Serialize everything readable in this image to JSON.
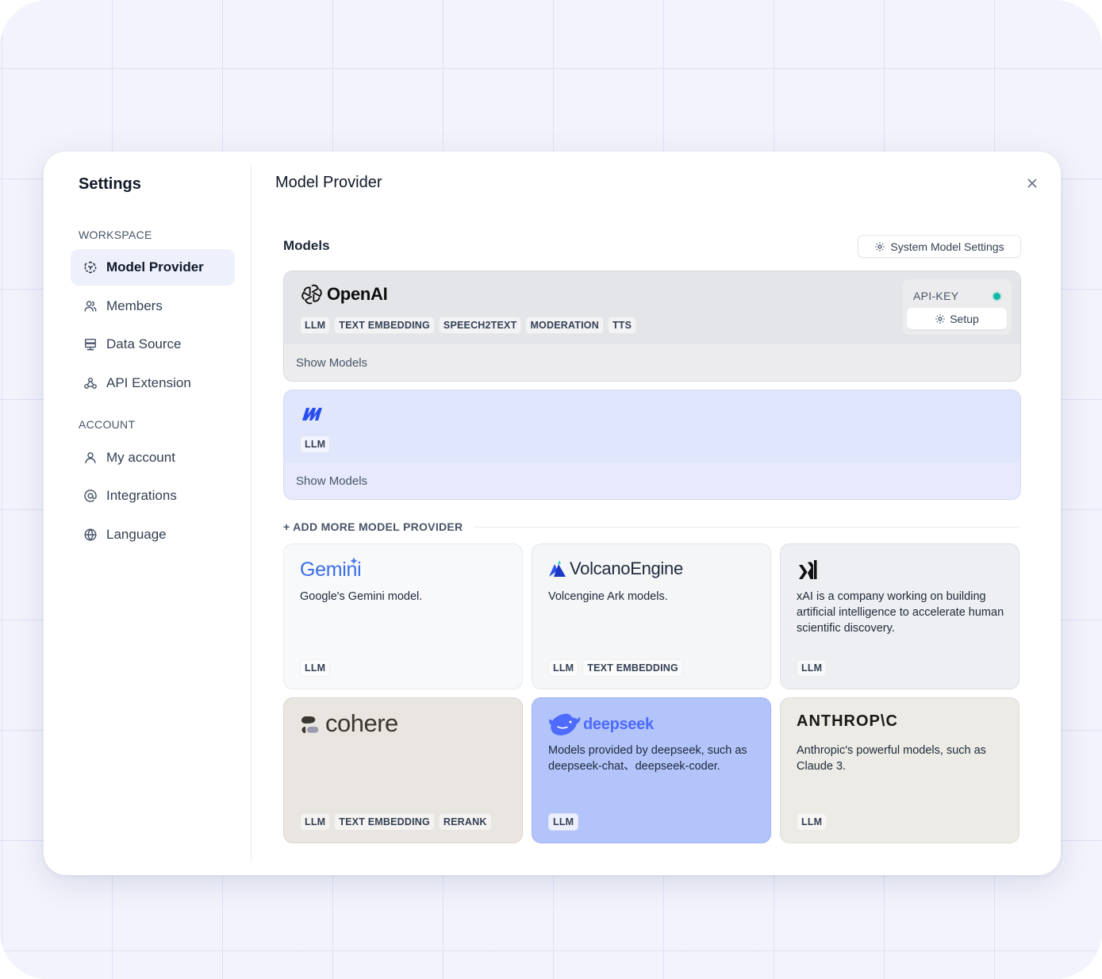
{
  "sidebar": {
    "title": "Settings",
    "workspace_label": "WORKSPACE",
    "account_label": "ACCOUNT",
    "items": [
      {
        "label": "Model Provider",
        "icon": "cube-icon",
        "active": true
      },
      {
        "label": "Members",
        "icon": "users-icon"
      },
      {
        "label": "Data Source",
        "icon": "database-icon"
      },
      {
        "label": "API Extension",
        "icon": "webhook-icon"
      },
      {
        "label": "My account",
        "icon": "user-icon"
      },
      {
        "label": "Integrations",
        "icon": "at-sign-icon"
      },
      {
        "label": "Language",
        "icon": "globe-icon"
      }
    ]
  },
  "main": {
    "title": "Model Provider",
    "models_label": "Models",
    "system_settings_label": "System Model Settings",
    "configured": [
      {
        "name": "OpenAI",
        "tags": [
          "LLM",
          "TEXT EMBEDDING",
          "SPEECH2TEXT",
          "MODERATION",
          "TTS"
        ],
        "api_key_label": "API-KEY",
        "setup_label": "Setup",
        "show_models": "Show Models",
        "status_color": "#14b8a6"
      },
      {
        "name": "",
        "icon": "moonshot-logo-icon",
        "tags": [
          "LLM"
        ],
        "show_models": "Show Models"
      }
    ],
    "add_more_label": "+ ADD MORE MODEL PROVIDER",
    "providers": [
      {
        "name": "Gemini",
        "desc": "Google's Gemini model.",
        "tags": [
          "LLM"
        ]
      },
      {
        "name": "VolcanoEngine",
        "desc": "Volcengine Ark models.",
        "tags": [
          "LLM",
          "TEXT EMBEDDING"
        ]
      },
      {
        "name": "xAI",
        "desc": "xAI is a company working on building artificial intelligence to accelerate human scientific discovery.",
        "tags": [
          "LLM"
        ]
      },
      {
        "name": "cohere",
        "desc": "",
        "tags": [
          "LLM",
          "TEXT EMBEDDING",
          "RERANK"
        ]
      },
      {
        "name": "deepseek",
        "desc": "Models provided by deepseek, such as deepseek-chat、deepseek-coder.",
        "tags": [
          "LLM"
        ]
      },
      {
        "name": "ANTHROP\\C",
        "desc": "Anthropic's powerful models, such as Claude 3.",
        "tags": [
          "LLM"
        ]
      }
    ]
  },
  "colors": {
    "accent_bg": "#eef0fc",
    "deepseek_card": "#b2c4fa",
    "deepseek_brand": "#4d6bfe",
    "gemini_brand": "#3b6ee8"
  }
}
